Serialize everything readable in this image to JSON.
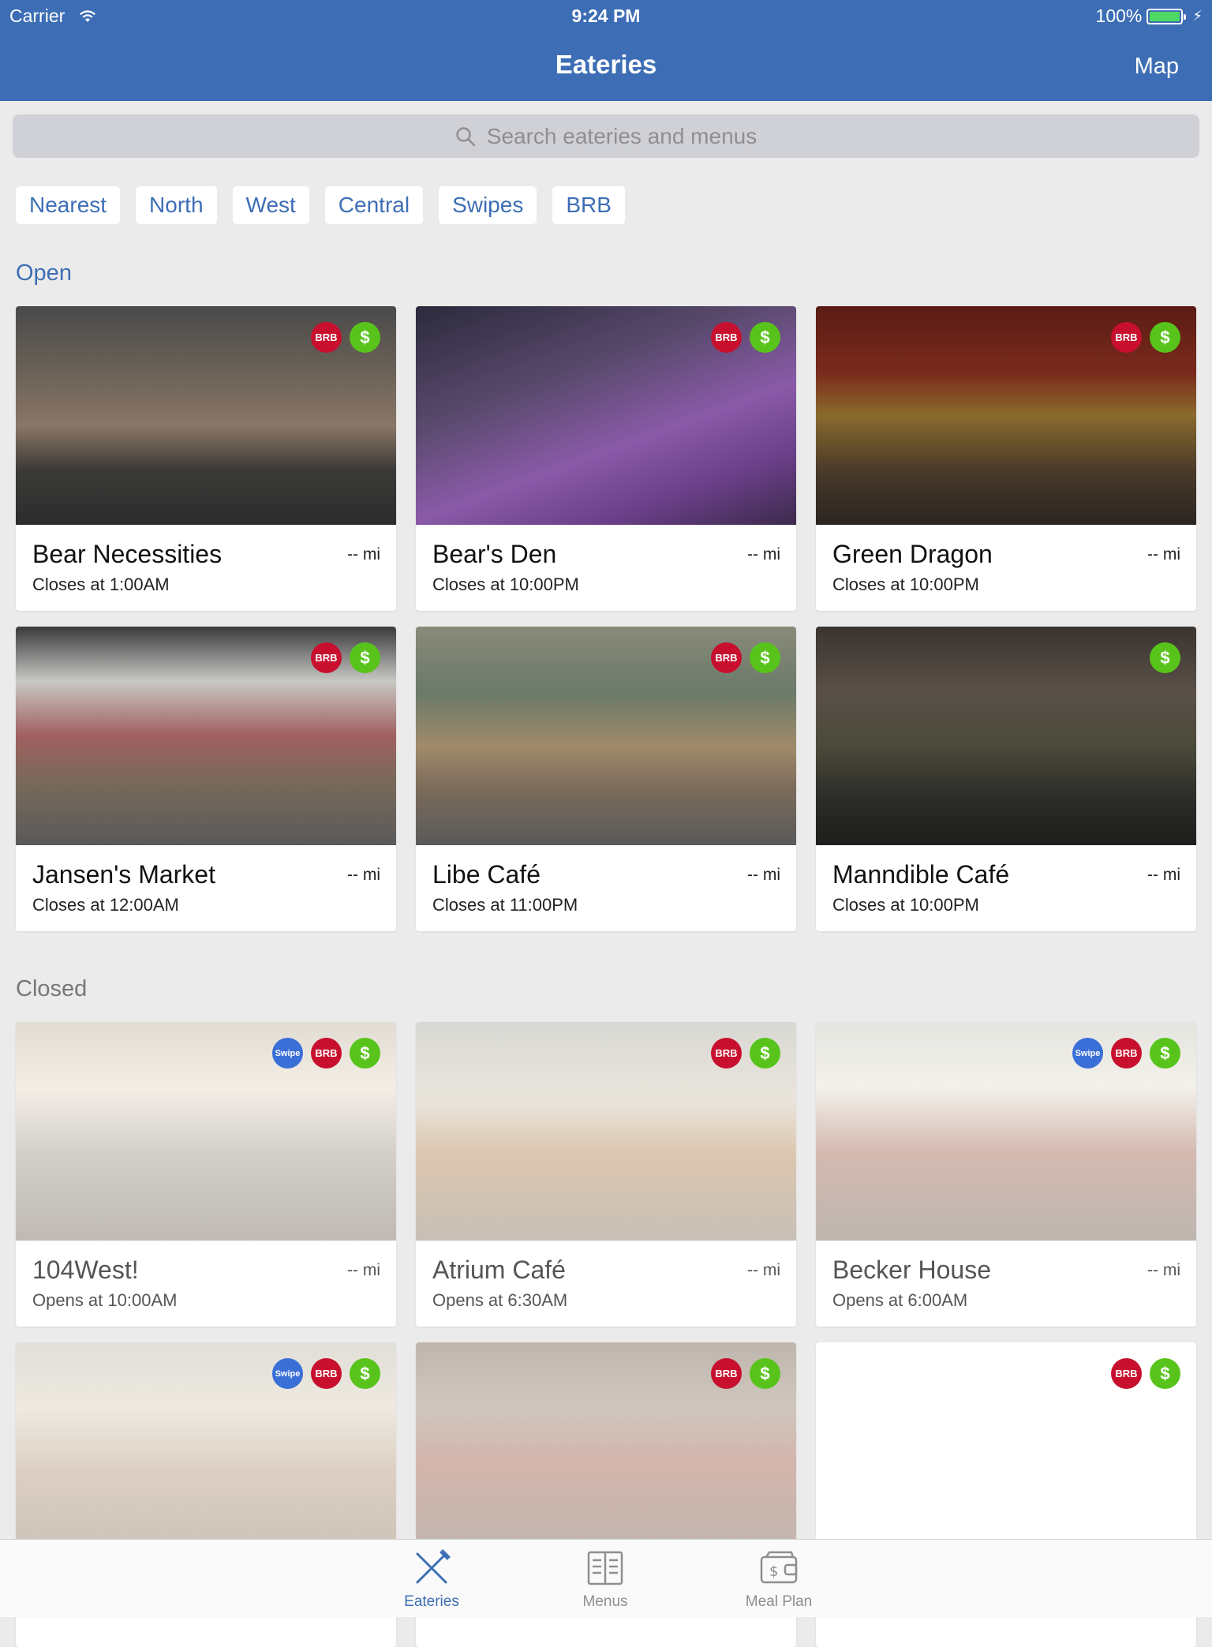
{
  "status_bar": {
    "carrier": "Carrier",
    "time": "9:24 PM",
    "battery": "100%"
  },
  "nav": {
    "title": "Eateries",
    "map": "Map"
  },
  "search": {
    "placeholder": "Search eateries and menus"
  },
  "filters": [
    "Nearest",
    "North",
    "West",
    "Central",
    "Swipes",
    "BRB"
  ],
  "sections": {
    "open": "Open",
    "closed": "Closed"
  },
  "open_eateries": [
    {
      "name": "Bear Necessities",
      "hours": "Closes at 1:00AM",
      "distance": "-- mi",
      "badges": [
        "BRB",
        "$"
      ]
    },
    {
      "name": "Bear's Den",
      "hours": "Closes at 10:00PM",
      "distance": "-- mi",
      "badges": [
        "BRB",
        "$"
      ]
    },
    {
      "name": "Green Dragon",
      "hours": "Closes at 10:00PM",
      "distance": "-- mi",
      "badges": [
        "BRB",
        "$"
      ]
    },
    {
      "name": "Jansen's Market",
      "hours": "Closes at 12:00AM",
      "distance": "-- mi",
      "badges": [
        "BRB",
        "$"
      ]
    },
    {
      "name": "Libe Café",
      "hours": "Closes at 11:00PM",
      "distance": "-- mi",
      "badges": [
        "BRB",
        "$"
      ]
    },
    {
      "name": "Manndible Café",
      "hours": "Closes at 10:00PM",
      "distance": "-- mi",
      "badges": [
        "$"
      ]
    }
  ],
  "closed_eateries": [
    {
      "name": "104West!",
      "hours": "Opens at 10:00AM",
      "distance": "-- mi",
      "badges": [
        "Swipe",
        "BRB",
        "$"
      ]
    },
    {
      "name": "Atrium Café",
      "hours": "Opens at 6:30AM",
      "distance": "-- mi",
      "badges": [
        "BRB",
        "$"
      ]
    },
    {
      "name": "Becker House",
      "hours": "Opens at 6:00AM",
      "distance": "-- mi",
      "badges": [
        "Swipe",
        "BRB",
        "$"
      ]
    },
    {
      "name": "",
      "hours": "",
      "distance": "",
      "badges": [
        "Swipe",
        "BRB",
        "$"
      ]
    },
    {
      "name": "",
      "hours": "",
      "distance": "",
      "badges": [
        "BRB",
        "$"
      ]
    },
    {
      "name": "",
      "hours": "",
      "distance": "",
      "badges": [
        "BRB",
        "$"
      ]
    }
  ],
  "tabs": [
    {
      "label": "Eateries",
      "icon": "fork-knife-icon",
      "active": true
    },
    {
      "label": "Menus",
      "icon": "menu-book-icon",
      "active": false
    },
    {
      "label": "Meal Plan",
      "icon": "wallet-icon",
      "active": false
    }
  ],
  "colors": {
    "brand": "#3d6eb5",
    "brb_badge": "#c8102e",
    "dollar_badge": "#58c41b",
    "swipe_badge": "#3a6fd8"
  }
}
